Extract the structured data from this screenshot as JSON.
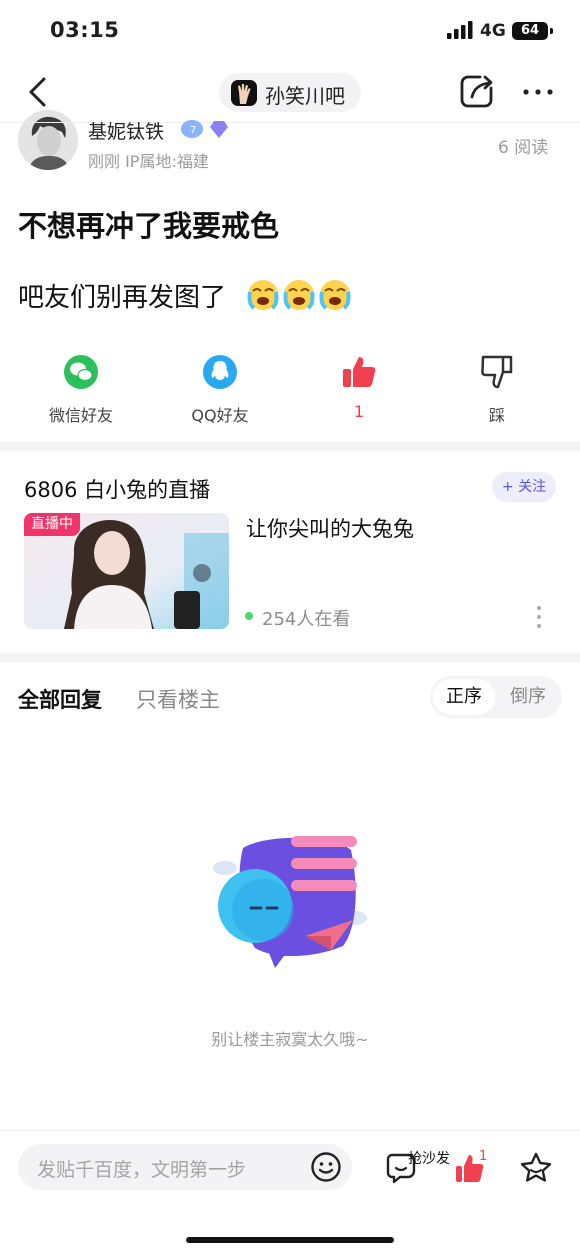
{
  "status_bar": {
    "time": "03:15",
    "network": "4G",
    "battery": "64"
  },
  "nav": {
    "forum_name": "孙笑川吧"
  },
  "post": {
    "author_name": "基妮钛铁",
    "meta": "刚刚  IP属地:福建",
    "read_count": "6 阅读",
    "title": "不想再冲了我要戒色",
    "body": "吧友们别再发图了"
  },
  "actions": [
    {
      "label": "微信好友"
    },
    {
      "label": "QQ好友"
    },
    {
      "label": "1"
    },
    {
      "label": "踩"
    }
  ],
  "live": {
    "title": "6806 白小兔的直播",
    "follow_label": "+ 关注",
    "badge": "直播中",
    "subtitle": "让你尖叫的大兔兔",
    "viewers": "254人在看"
  },
  "replies": {
    "tab_all": "全部回复",
    "tab_host_only": "只看楼主",
    "sort_asc": "正序",
    "sort_desc": "倒序",
    "empty_text": "别让楼主寂寞太久哦~"
  },
  "bottom_bar": {
    "input_placeholder": "发贴千百度，文明第一步",
    "sofa_label": "抢沙发",
    "like_count": "1"
  },
  "colors": {
    "accent_red": "#f0404f",
    "accent_purple": "#5b52e6",
    "wechat_green": "#2bc05c",
    "qq_blue": "#27a9f2"
  }
}
